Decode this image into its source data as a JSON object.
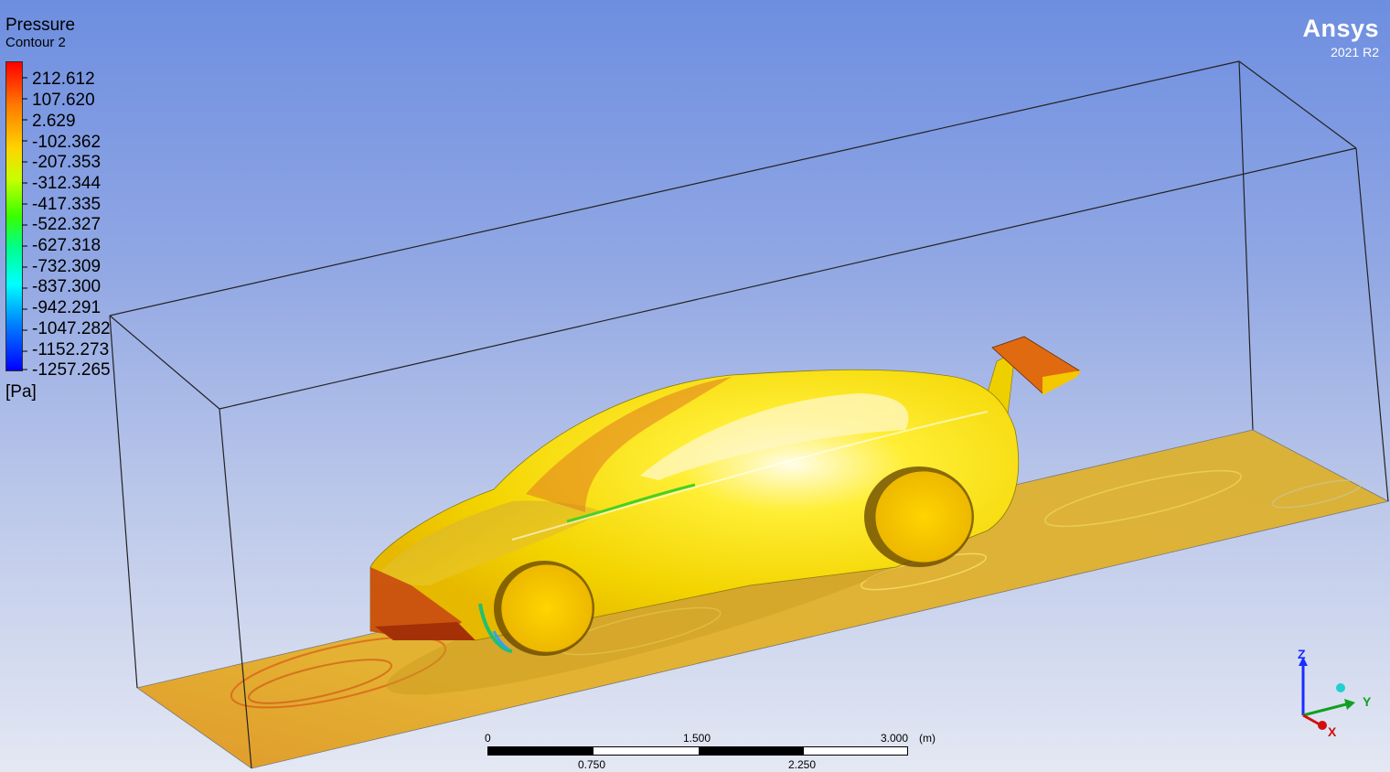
{
  "legend": {
    "title": "Pressure",
    "subtitle": "Contour 2",
    "unit": "[Pa]",
    "values": [
      "212.612",
      "107.620",
      "2.629",
      "-102.362",
      "-207.353",
      "-312.344",
      "-417.335",
      "-522.327",
      "-627.318",
      "-732.309",
      "-837.300",
      "-942.291",
      "-1047.282",
      "-1152.273",
      "-1257.265"
    ]
  },
  "brand": {
    "name": "Ansys",
    "version": "2021 R2"
  },
  "scale": {
    "label_0": "0",
    "label_1500": "1.500",
    "label_3000": "3.000",
    "unit": "(m)",
    "label_0750": "0.750",
    "label_2250": "2.250"
  },
  "triad": {
    "z": "Z",
    "y": "Y",
    "x": "X"
  },
  "colors": {
    "max": "#ff0000",
    "high": "#ff7a00",
    "mid": "#ffd400",
    "low_mid": "#38ff00",
    "low": "#00ffff",
    "min": "#0000ff"
  }
}
